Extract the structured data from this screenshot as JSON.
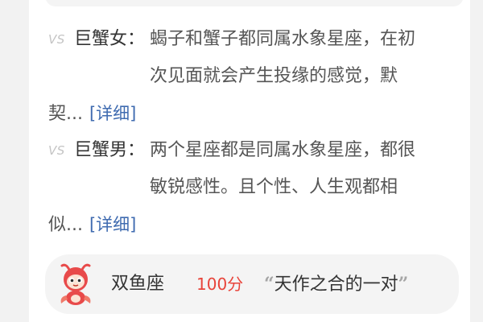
{
  "matches": [
    {
      "vs": "VS",
      "role": "巨蟹女：",
      "lines": [
        "蝎子和蟹子都同属水象星座，在初",
        "次见面就会产生投缘的感觉，默",
        "契..."
      ],
      "more": "[详细]"
    },
    {
      "vs": "VS",
      "role": "巨蟹男：",
      "lines": [
        "两个星座都是同属水象星座，都很",
        "敏锐感性。且个性、人生观都相",
        "似..."
      ],
      "more": "[详细]"
    }
  ],
  "pisces_card": {
    "avatar_icon": "pisces-mascot-icon",
    "sign": "双鱼座",
    "score": "100分",
    "open_quote": "“",
    "quote": "天作之合的一对",
    "close_quote": "”"
  },
  "colors": {
    "link": "#3f6bb0",
    "score": "#e8443a",
    "mascot_red": "#e84a4a"
  }
}
